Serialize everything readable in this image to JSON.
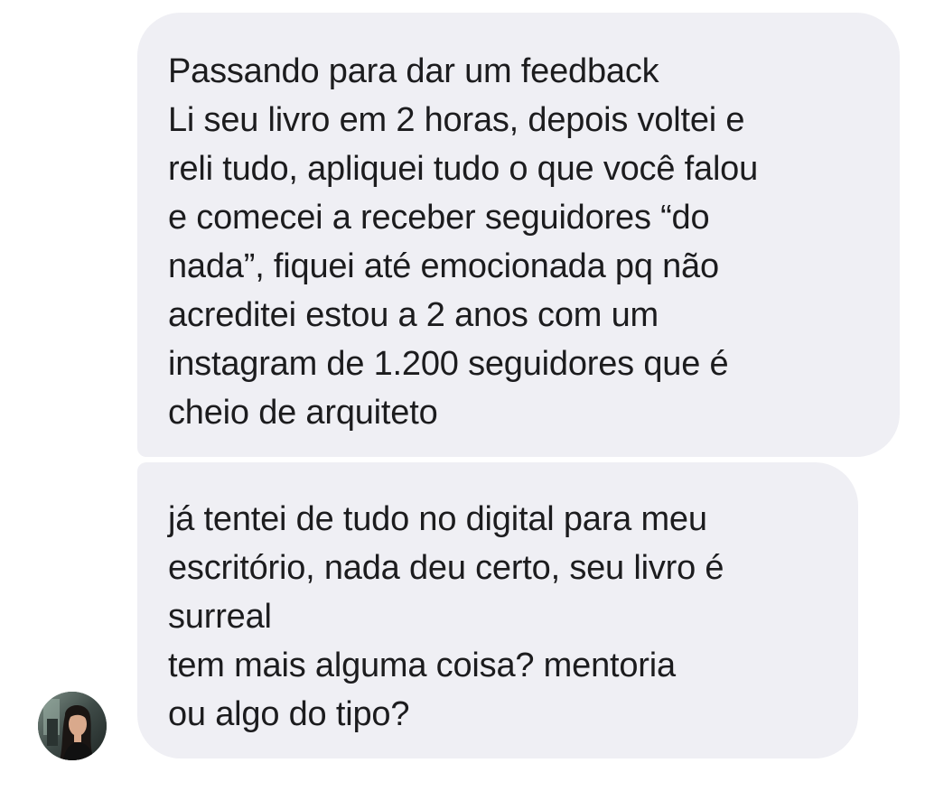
{
  "conversation": {
    "messages": [
      {
        "lines": [
          "Passando para dar um feedback",
          "Li seu livro em 2 horas, depois voltei e",
          "reli tudo, apliquei tudo o que você falou",
          "e comecei a receber seguidores “do",
          "nada”, fiquei até emocionada pq não",
          "acreditei estou a 2 anos com um",
          "instagram de 1.200 seguidores que é",
          "cheio de arquiteto"
        ]
      },
      {
        "lines": [
          "já tentei de tudo no digital para meu",
          "escritório, nada deu certo, seu livro é",
          "surreal",
          "tem mais alguma coisa? mentoria",
          "ou algo do tipo?"
        ]
      }
    ],
    "sender_avatar_icon": "user-avatar-photo",
    "colors": {
      "bubble_background": "#efeff4",
      "text": "#1c1c1e",
      "page_background": "#ffffff"
    }
  }
}
